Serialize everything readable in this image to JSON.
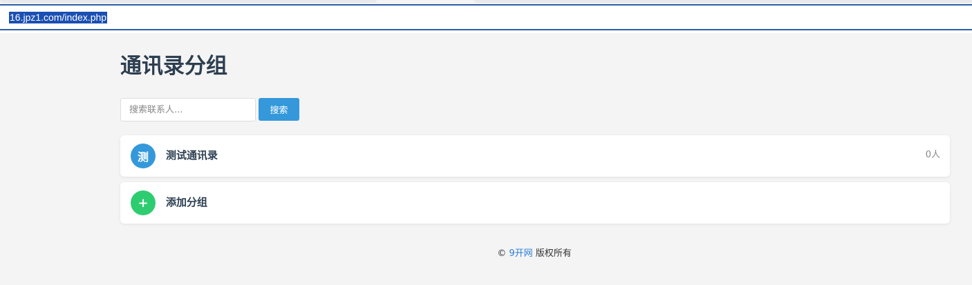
{
  "browser": {
    "url": "16.jpz1.com/index.php"
  },
  "page": {
    "title": "通讯录分组"
  },
  "search": {
    "placeholder": "搜索联系人...",
    "button_label": "搜索"
  },
  "groups": [
    {
      "avatar_text": "测",
      "name": "测试通讯录",
      "count": "0人",
      "avatar_color": "#3498db"
    },
    {
      "avatar_text": "+",
      "name": "添加分组",
      "avatar_color": "#2ecc71"
    }
  ],
  "footer": {
    "copyright_symbol": "©",
    "site_link": "9开网",
    "rights": "版权所有"
  }
}
